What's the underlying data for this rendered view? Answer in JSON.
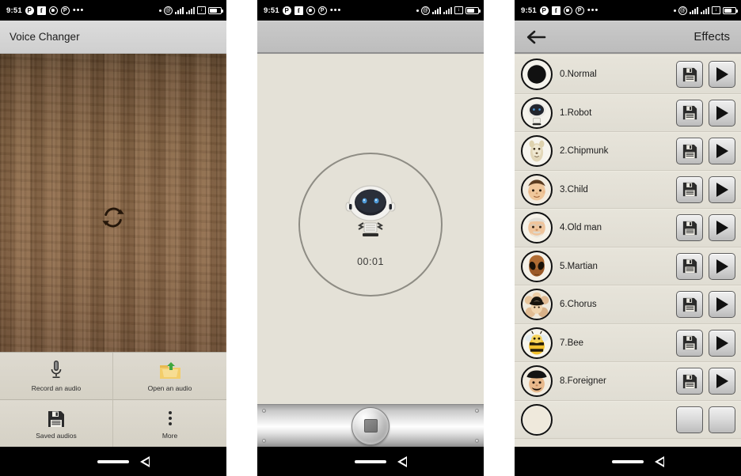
{
  "statusbar": {
    "clock": "9:51",
    "left_icons": [
      "pinterest-icon",
      "facebook-icon",
      "whatsapp-icon",
      "p-circle-icon",
      "overflow-dots-icon"
    ],
    "right_icons": [
      "dot-indicator",
      "at-circle-icon",
      "signal-bars-icon",
      "dual-signal-icon",
      "vibrate-icon",
      "battery-icon"
    ],
    "overflow": "•••",
    "p_label": "P",
    "f_label": "f",
    "pin_label": "P",
    "at_label": "@",
    "vib_label": "↕"
  },
  "navbar": {
    "home": "home-pill",
    "back": "back-triangle"
  },
  "phone1": {
    "header": {
      "title": "Voice Changer"
    },
    "canvas": {
      "icon": "refresh-sync-icon"
    },
    "buttons": [
      {
        "label": "Record an audio",
        "icon": "microphone-icon"
      },
      {
        "label": "Open an audio",
        "icon": "open-folder-icon"
      },
      {
        "label": "Saved audios",
        "icon": "floppy-disk-icon"
      },
      {
        "label": "More",
        "icon": "vertical-dots-icon"
      }
    ]
  },
  "phone2": {
    "header": {
      "title": ""
    },
    "preview": {
      "avatar": "robot-avatar",
      "timer": "00:01"
    },
    "transport": {
      "button": "stop-recording-button",
      "icon": "stop-square-icon"
    }
  },
  "phone3": {
    "header": {
      "back": "back-arrow-icon",
      "title": "Effects"
    },
    "row_actions": {
      "save": "floppy-disk-icon",
      "play": "play-triangle-icon"
    },
    "effects": [
      {
        "label": "0.Normal",
        "avatar": "normal-black-circle-avatar"
      },
      {
        "label": "1.Robot",
        "avatar": "robot-avatar"
      },
      {
        "label": "2.Chipmunk",
        "avatar": "chipmunk-avatar"
      },
      {
        "label": "3.Child",
        "avatar": "child-avatar"
      },
      {
        "label": "4.Old man",
        "avatar": "old-man-avatar"
      },
      {
        "label": "5.Martian",
        "avatar": "martian-avatar"
      },
      {
        "label": "6.Chorus",
        "avatar": "chorus-crowd-avatar"
      },
      {
        "label": "7.Bee",
        "avatar": "bee-avatar"
      },
      {
        "label": "8.Foreigner",
        "avatar": "foreigner-avatar"
      },
      {
        "label": "",
        "avatar": "cut-off-avatar"
      }
    ]
  },
  "colors": {
    "status_bar": "#000000",
    "header_gray": "#c6c6c6",
    "panel_bg": "#e4e1d7",
    "wood_mid": "#8d6845",
    "wood_dark": "#5c4228",
    "ring_stroke": "#8e8c84",
    "text_dark": "#1b1b1b",
    "separator": "#d0ccc1",
    "page_gap": "#ffffff"
  }
}
